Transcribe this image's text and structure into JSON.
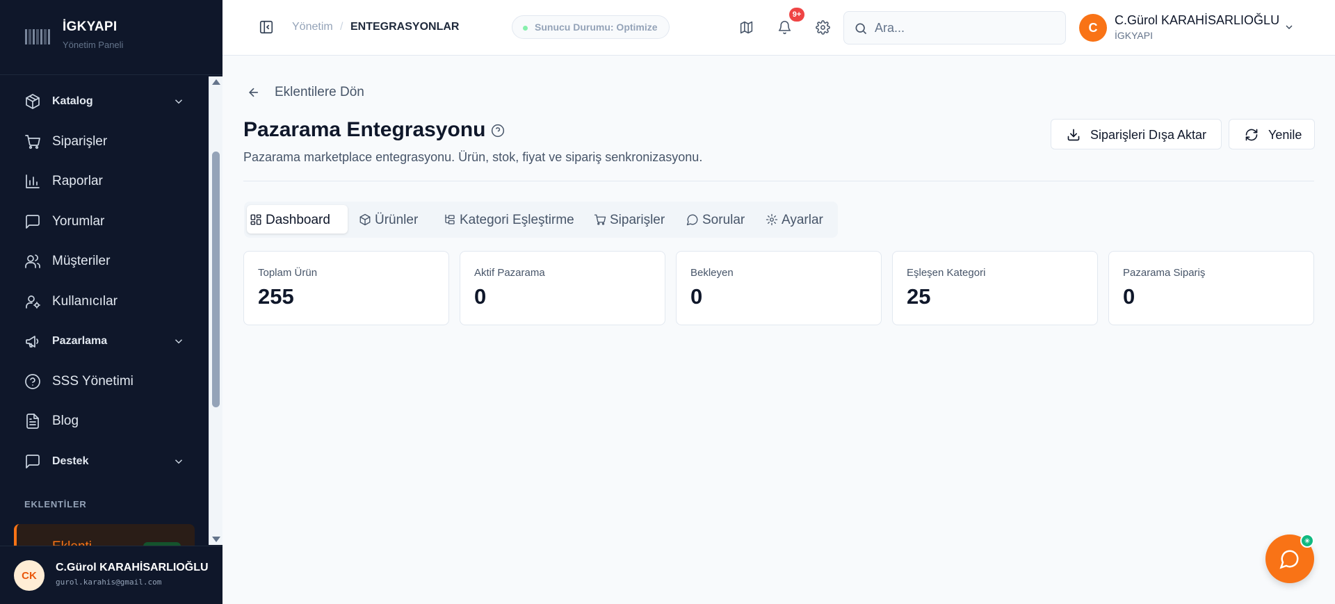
{
  "brand": {
    "name": "İGKYAPI",
    "subtitle": "Yönetim Paneli"
  },
  "sidebar": {
    "items": [
      {
        "label": "Katalog",
        "icon": "package-icon",
        "expandable": true
      },
      {
        "label": "Siparişler",
        "icon": "cart-icon"
      },
      {
        "label": "Raporlar",
        "icon": "bar-chart-icon"
      },
      {
        "label": "Yorumlar",
        "icon": "message-icon"
      },
      {
        "label": "Müşteriler",
        "icon": "users-icon"
      },
      {
        "label": "Kullanıcılar",
        "icon": "user-cog-icon"
      },
      {
        "label": "Pazarlama",
        "icon": "megaphone-icon",
        "expandable": true
      },
      {
        "label": "SSS Yönetimi",
        "icon": "help-circle-icon"
      },
      {
        "label": "Blog",
        "icon": "file-text-icon"
      },
      {
        "label": "Destek",
        "icon": "message-square-icon",
        "expandable": true
      }
    ],
    "section_label": "EKLENTİLER",
    "active_item": {
      "label": "Eklenti"
    }
  },
  "user_footer": {
    "initials": "CK",
    "name": "C.Gürol KARAHİSARLIOĞLU",
    "email": "gurol.karahis@gmail.com"
  },
  "header": {
    "breadcrumb": {
      "root": "Yönetim",
      "separator": "/",
      "current": "ENTEGRASYONLAR"
    },
    "status": "Sunucu Durumu: Optimize",
    "notification_count": "9+",
    "search": {
      "placeholder": "Ara..."
    },
    "profile": {
      "initial": "C",
      "name": "C.Gürol KARAHİSARLIOĞLU",
      "org": "İGKYAPI"
    }
  },
  "main": {
    "back_label": "Eklentilere Dön",
    "title": "Pazarama Entegrasyonu",
    "description": "Pazarama marketplace entegrasyonu. Ürün, stok, fiyat ve sipariş senkronizasyonu.",
    "actions": {
      "export_label": "Siparişleri Dışa Aktar",
      "refresh_label": "Yenile"
    },
    "tabs": [
      {
        "label": "Dashboard",
        "icon": "grid-icon",
        "active": true
      },
      {
        "label": "Ürünler",
        "icon": "box-icon"
      },
      {
        "label": "Kategori Eşleştirme",
        "icon": "tree-icon"
      },
      {
        "label": "Siparişler",
        "icon": "cart-icon"
      },
      {
        "label": "Sorular",
        "icon": "message-circle-icon"
      },
      {
        "label": "Ayarlar",
        "icon": "gear-icon"
      }
    ],
    "stats": [
      {
        "label": "Toplam Ürün",
        "value": "255"
      },
      {
        "label": "Aktif Pazarama",
        "value": "0"
      },
      {
        "label": "Bekleyen",
        "value": "0"
      },
      {
        "label": "Eşleşen Kategori",
        "value": "25"
      },
      {
        "label": "Pazarama Sipariş",
        "value": "0"
      }
    ]
  },
  "colors": {
    "accent": "#f97316",
    "sidebar_bg": "#0f172a",
    "badge": "#ef4444",
    "status_dot": "#86efac"
  }
}
